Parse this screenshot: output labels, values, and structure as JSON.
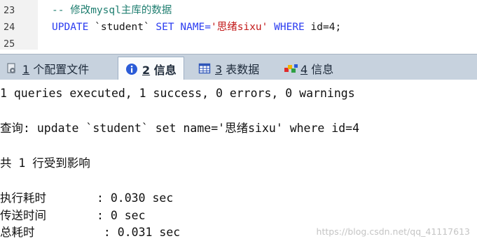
{
  "editor": {
    "lines": [
      {
        "number": "23",
        "text": "-- 修改mysql主库的数据"
      },
      {
        "number": "24",
        "keyword_update": "UPDATE",
        "table": " `student` ",
        "keyword_set": "SET",
        "column": " NAME=",
        "value": "'思绪sixu'",
        "keyword_where": " WHERE",
        "cond": " id=4;"
      },
      {
        "number": "25",
        "text": ""
      }
    ],
    "colors": {
      "keyword": "#2b3cf0",
      "comment": "#1f7e70",
      "string": "#c21818"
    }
  },
  "tabs": [
    {
      "number": "1",
      "label": "个配置文件",
      "icon": "config-file-icon",
      "active": false
    },
    {
      "number": "2",
      "label": "信息",
      "icon": "info-icon",
      "active": true
    },
    {
      "number": "3",
      "label": "表数据",
      "icon": "table-data-icon",
      "active": false
    },
    {
      "number": "4",
      "label": "信息",
      "icon": "info-blocks-icon",
      "active": false
    }
  ],
  "messages": {
    "summary": "1 queries executed, 1 success, 0 errors, 0 warnings",
    "query_label": "查询:",
    "query_text": " update `student` set name='思绪sixu' where id=4",
    "affected": "共 1 行受到影响",
    "stats": [
      {
        "label": "执行耗时",
        "value": ": 0.030 sec"
      },
      {
        "label": "传送时间",
        "value": ": 0 sec"
      },
      {
        "label": "总耗时",
        "value": " : 0.031 sec"
      }
    ]
  },
  "watermark": "https://blog.csdn.net/qq_41117613"
}
